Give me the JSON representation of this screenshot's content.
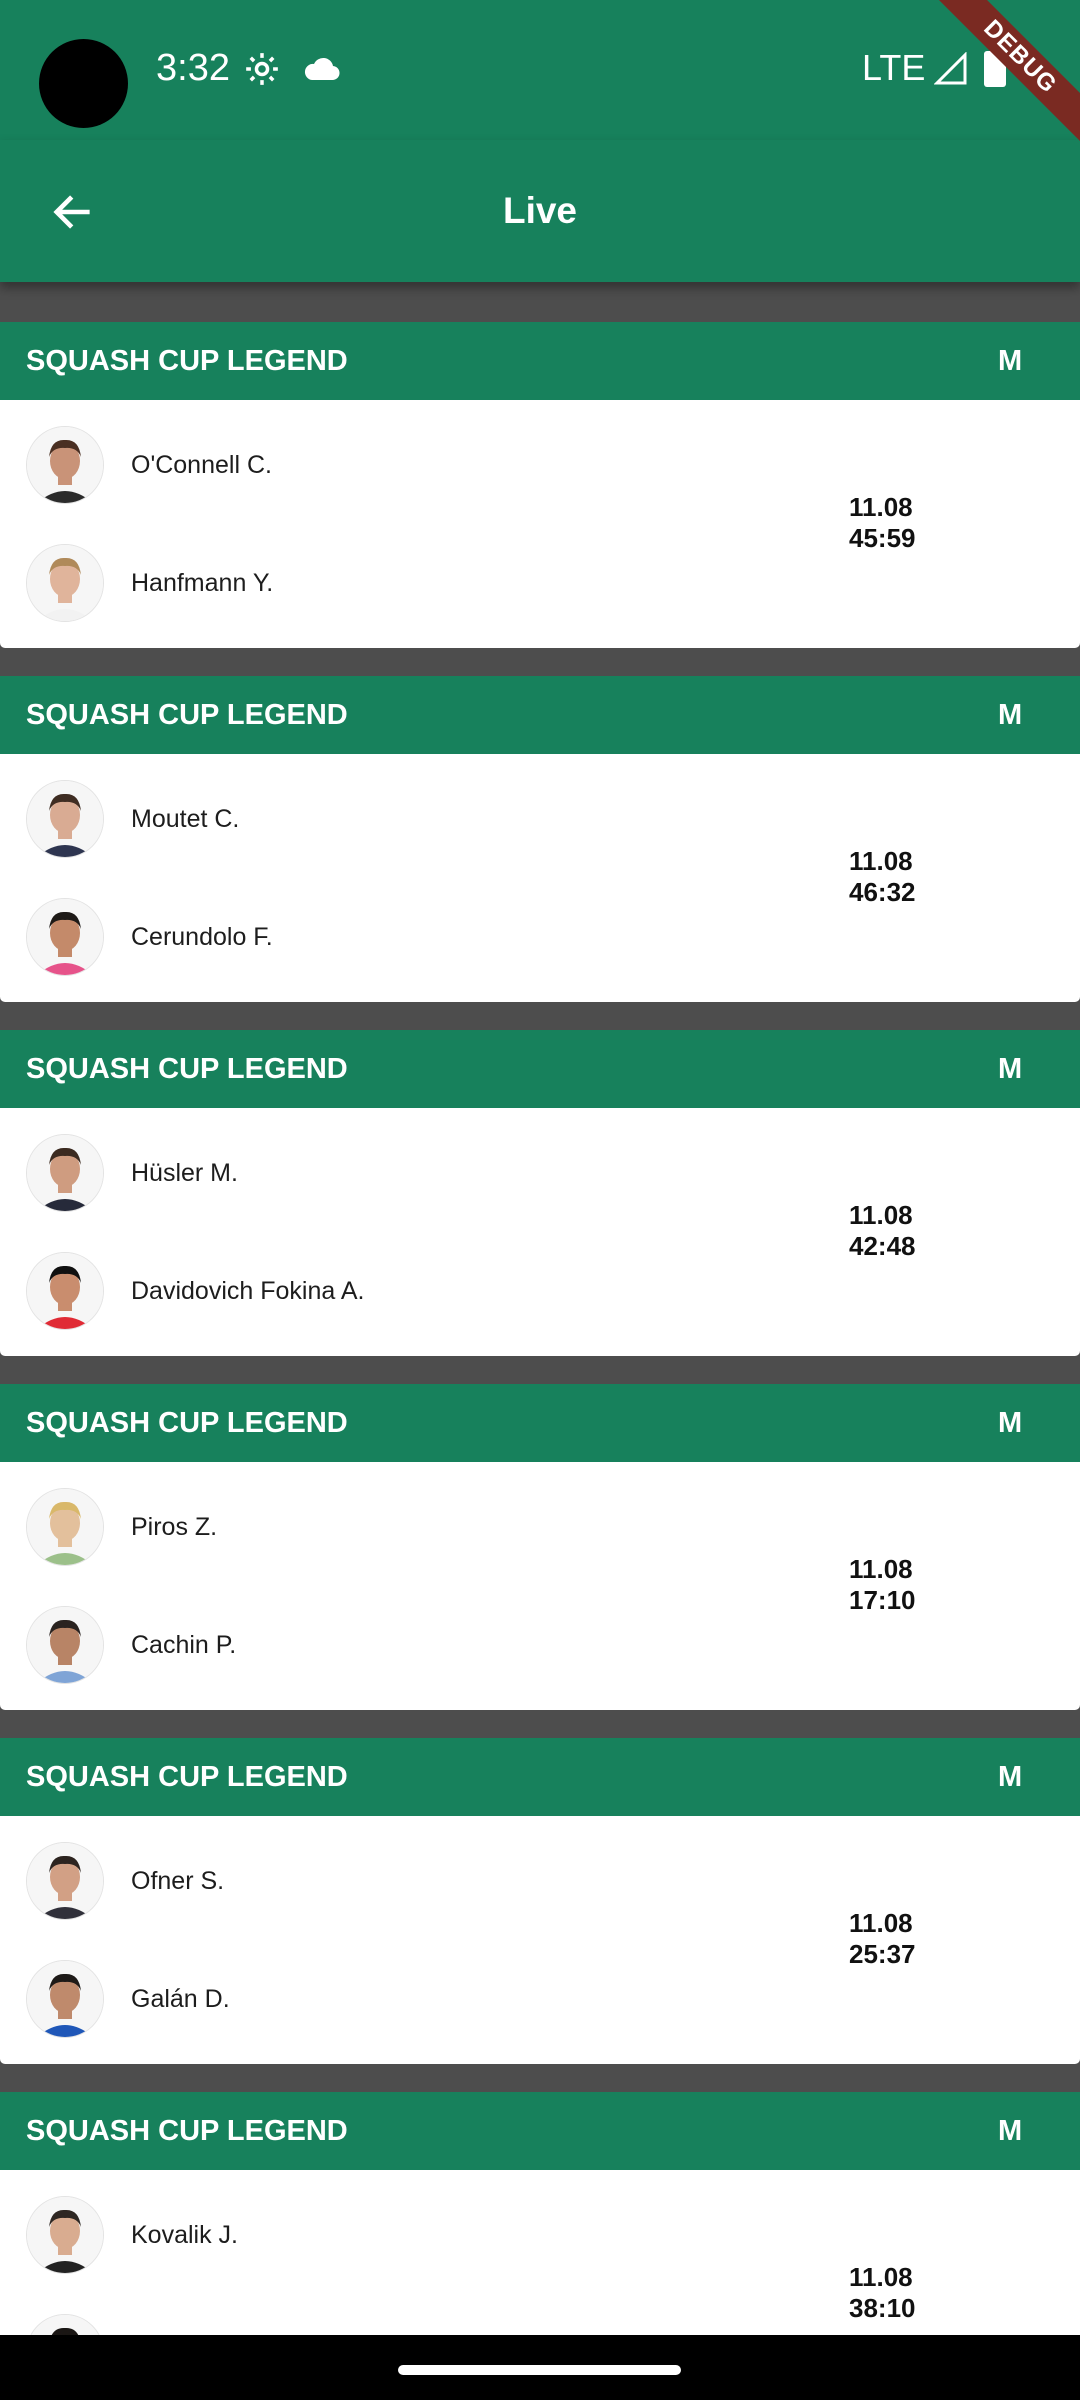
{
  "status_bar": {
    "time": "3:32",
    "network": "LTE",
    "debug_label": "DEBUG",
    "icons": [
      "settings-gear-icon",
      "cloud-icon",
      "signal-icon",
      "battery-icon"
    ]
  },
  "app_bar": {
    "title": "Live",
    "back_icon": "arrow-back-icon"
  },
  "colors": {
    "primary": "#17815c",
    "background": "#4d4d4d",
    "card": "#ffffff",
    "debug_ribbon": "#7a2a22"
  },
  "matches": [
    {
      "league": "SQUASH CUP LEGEND",
      "gender": "M",
      "player1": {
        "name": "O'Connell C.",
        "skin": "#c99378",
        "hair": "#4a2f22",
        "shirt": "#2b2b2b"
      },
      "player2": {
        "name": "Hanfmann Y.",
        "skin": "#e0b49b",
        "hair": "#b08a5a",
        "shirt": "#f2f2f2"
      },
      "date": "11.08",
      "time": "45:59"
    },
    {
      "league": "SQUASH CUP LEGEND",
      "gender": "M",
      "player1": {
        "name": "Moutet C.",
        "skin": "#d9ab93",
        "hair": "#3f2d23",
        "shirt": "#2e3550"
      },
      "player2": {
        "name": "Cerundolo F.",
        "skin": "#c48a6a",
        "hair": "#1e1a17",
        "shirt": "#e6538a"
      },
      "date": "11.08",
      "time": "46:32"
    },
    {
      "league": "SQUASH CUP LEGEND",
      "gender": "M",
      "player1": {
        "name": "Hüsler M.",
        "skin": "#cf9c80",
        "hair": "#3b2a20",
        "shirt": "#262a3a"
      },
      "player2": {
        "name": "Davidovich Fokina A.",
        "skin": "#c98d6e",
        "hair": "#111111",
        "shirt": "#e02b35"
      },
      "date": "11.08",
      "time": "42:48"
    },
    {
      "league": "SQUASH CUP LEGEND",
      "gender": "M",
      "player1": {
        "name": "Piros Z.",
        "skin": "#e3c09c",
        "hair": "#d9b86a",
        "shirt": "#9cc08a"
      },
      "player2": {
        "name": "Cachin P.",
        "skin": "#b88466",
        "hair": "#2a2320",
        "shirt": "#7fa4d6"
      },
      "date": "11.08",
      "time": "17:10"
    },
    {
      "league": "SQUASH CUP LEGEND",
      "gender": "M",
      "player1": {
        "name": "Ofner S.",
        "skin": "#d2a085",
        "hair": "#2d2420",
        "shirt": "#30303a"
      },
      "player2": {
        "name": "Galán D.",
        "skin": "#bf8a6c",
        "hair": "#1e1a18",
        "shirt": "#1f57b8"
      },
      "date": "11.08",
      "time": "25:37"
    },
    {
      "league": "SQUASH CUP LEGEND",
      "gender": "M",
      "player1": {
        "name": "Kovalik J.",
        "skin": "#d9ac90",
        "hair": "#2e2723",
        "shirt": "#222222"
      },
      "player2": {
        "name": "",
        "skin": "#b97a5c",
        "hair": "#1a1614",
        "shirt": "#333333"
      },
      "date": "11.08",
      "time": "38:10"
    }
  ]
}
